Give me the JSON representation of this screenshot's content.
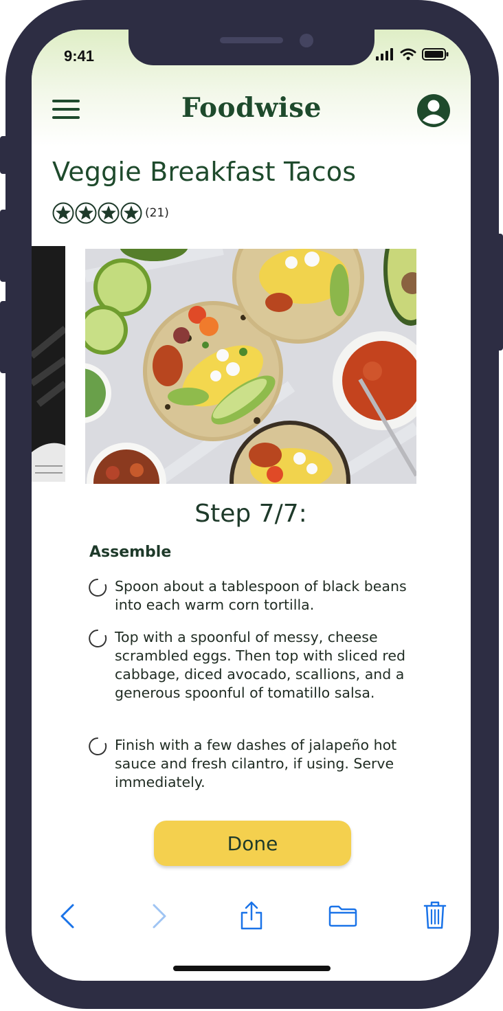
{
  "status_bar": {
    "time": "9:41"
  },
  "header": {
    "app_title": "Foodwise"
  },
  "recipe": {
    "title": "Veggie Breakfast Tacos",
    "rating_stars": 4,
    "rating_max": 4,
    "rating_count": "(21)"
  },
  "step": {
    "title": "Step 7/7:",
    "section": "Assemble",
    "tasks": [
      {
        "text": "Spoon about a tablespoon of black beans into each warm corn tortilla.",
        "checked": false
      },
      {
        "text": "Top with a spoonful of messy, cheese scrambled eggs. Then top with sliced red cabbage, diced avocado, scallions, and a generous spoonful of tomatillo salsa.",
        "checked": false
      },
      {
        "text": "Finish with a few dashes of jalapeño hot sauce and fresh cilantro, if using. Serve immediately.",
        "checked": false
      }
    ]
  },
  "done_button": {
    "label": "Done"
  },
  "toolbar": {
    "icons": [
      "back-icon",
      "forward-icon",
      "share-icon",
      "folder-icon",
      "trash-icon"
    ]
  },
  "colors": {
    "brand_green": "#1e4a2c",
    "accent_yellow": "#f4d04e",
    "toolbar_blue": "#1a73e8",
    "frame": "#2d2d43"
  }
}
